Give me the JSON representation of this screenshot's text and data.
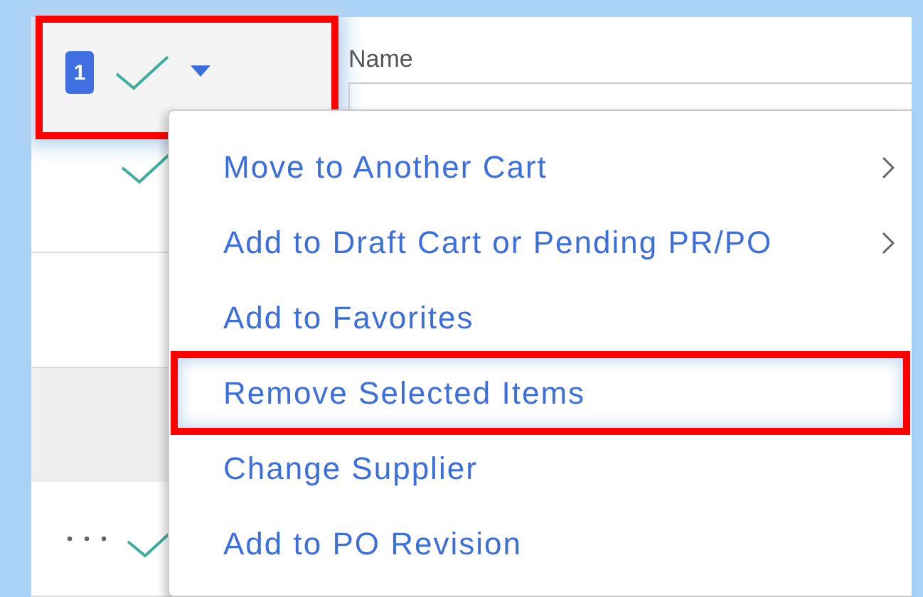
{
  "selection": {
    "count": "1",
    "highlighted": true
  },
  "column_header": {
    "label": "Name"
  },
  "rows": [
    {
      "kind": "check",
      "shaded": false
    },
    {
      "kind": "blank",
      "shaded": false
    },
    {
      "kind": "blank",
      "shaded": true
    },
    {
      "kind": "more-check",
      "shaded": false
    }
  ],
  "menu": {
    "items": [
      {
        "label": "Move to Another Cart",
        "submenu": true,
        "highlighted": false
      },
      {
        "label": "Add to Draft Cart or Pending PR/PO",
        "submenu": true,
        "highlighted": false
      },
      {
        "label": "Add to Favorites",
        "submenu": false,
        "highlighted": false
      },
      {
        "label": "Remove Selected Items",
        "submenu": false,
        "highlighted": true
      },
      {
        "label": "Change Supplier",
        "submenu": false,
        "highlighted": false
      },
      {
        "label": "Add to PO Revision",
        "submenu": false,
        "highlighted": false
      }
    ]
  }
}
